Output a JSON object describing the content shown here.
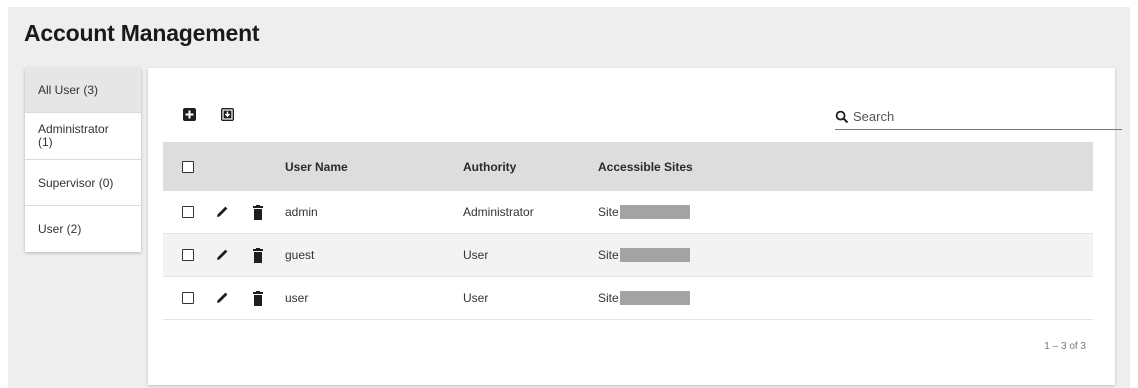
{
  "page": {
    "title": "Account Management"
  },
  "sidebar": {
    "items": [
      {
        "label": "All User (3)",
        "active": true
      },
      {
        "label": "Administrator\n(1)",
        "active": false
      },
      {
        "label": "Supervisor (0)",
        "active": false
      },
      {
        "label": "User (2)",
        "active": false
      }
    ]
  },
  "toolbar": {
    "add_icon": "add-box-icon",
    "import_icon": "import-box-icon"
  },
  "search": {
    "placeholder": "Search",
    "value": "",
    "icon": "search-icon"
  },
  "table": {
    "columns": [
      "User Name",
      "Authority",
      "Accessible Sites"
    ],
    "rows": [
      {
        "username": "admin",
        "authority": "Administrator",
        "site_prefix": "Site"
      },
      {
        "username": "guest",
        "authority": "User",
        "site_prefix": "Site"
      },
      {
        "username": "user",
        "authority": "User",
        "site_prefix": "Site"
      }
    ],
    "row_icons": [
      "edit-pencil-icon",
      "delete-trash-icon"
    ]
  },
  "pagination": {
    "label": "1 – 3 of 3"
  },
  "colors": {
    "page_bg": "#eeeeee",
    "header_bg": "#dddddd",
    "active_tab_bg": "#e6e6e6",
    "icon": "#1e1e1e",
    "redacted": "#a3a3a3"
  }
}
